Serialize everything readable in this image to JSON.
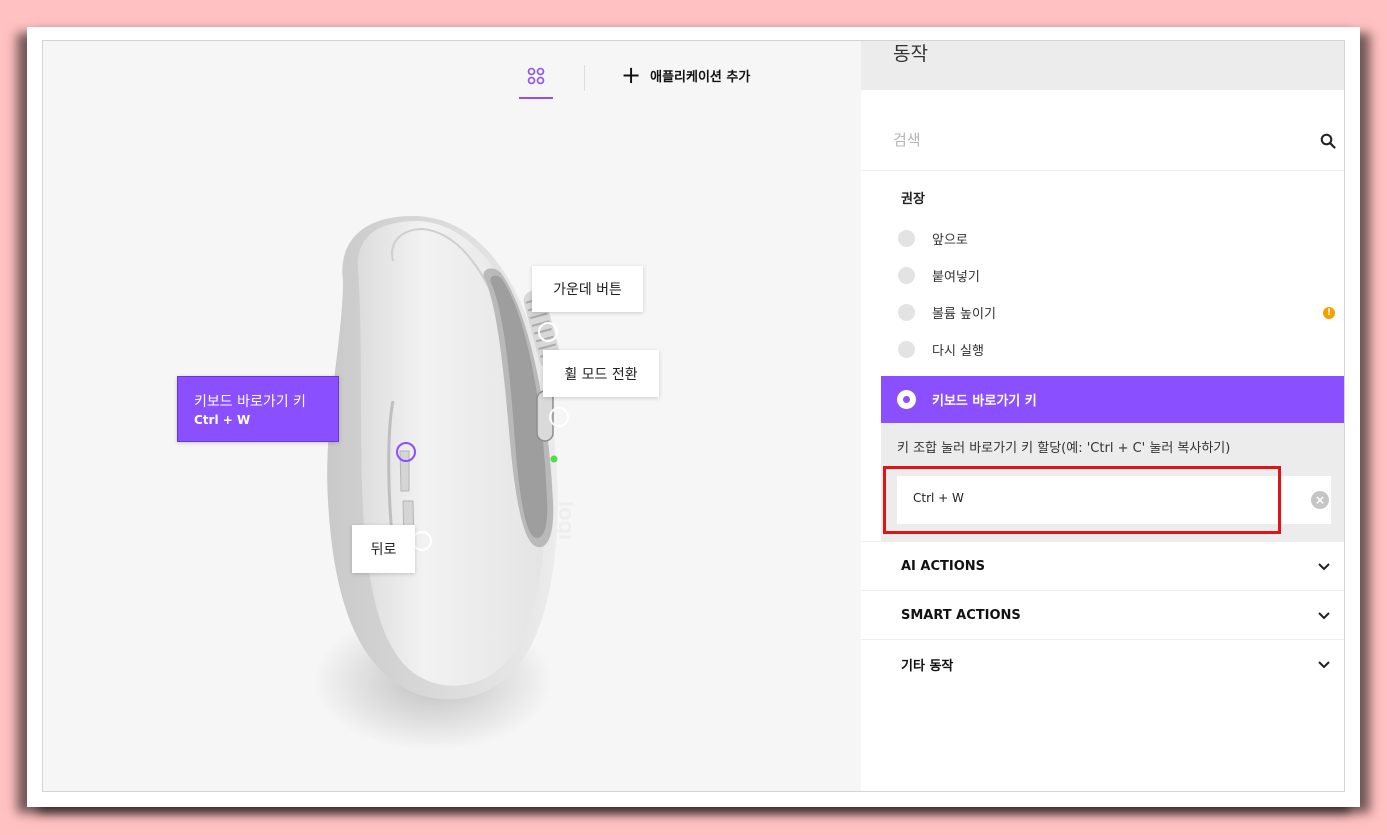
{
  "header": {
    "add_application_label": "애플리케이션 추가"
  },
  "device": {
    "callouts": {
      "middle_button": "가운데 버튼",
      "wheel_mode": "휠 모드 전환",
      "back": "뒤로",
      "active_title": "키보드 바로가기 키",
      "active_value": "Ctrl + W"
    },
    "brand_mark": "logi"
  },
  "panel": {
    "title": "동작",
    "search": {
      "placeholder": "검색",
      "value": ""
    },
    "recommended": {
      "title": "권장",
      "items": [
        {
          "label": "앞으로"
        },
        {
          "label": "붙여넣기"
        },
        {
          "label": "볼륨 높이기",
          "warning": "!"
        },
        {
          "label": "다시 실행"
        }
      ]
    },
    "selected": {
      "label": "키보드 바로가기 키",
      "description": "키 조합 눌러 바로가기 키 할당(예: 'Ctrl + C' 눌러 복사하기)",
      "value": "Ctrl + W",
      "clear": "×"
    },
    "sections": [
      {
        "label": "AI ACTIONS"
      },
      {
        "label": "SMART ACTIONS"
      },
      {
        "label": "기타 동작"
      }
    ]
  },
  "colors": {
    "accent": "#8a4fff",
    "highlight": "#e01414",
    "background": "#ffc1c1",
    "warning": "#f5a000"
  }
}
